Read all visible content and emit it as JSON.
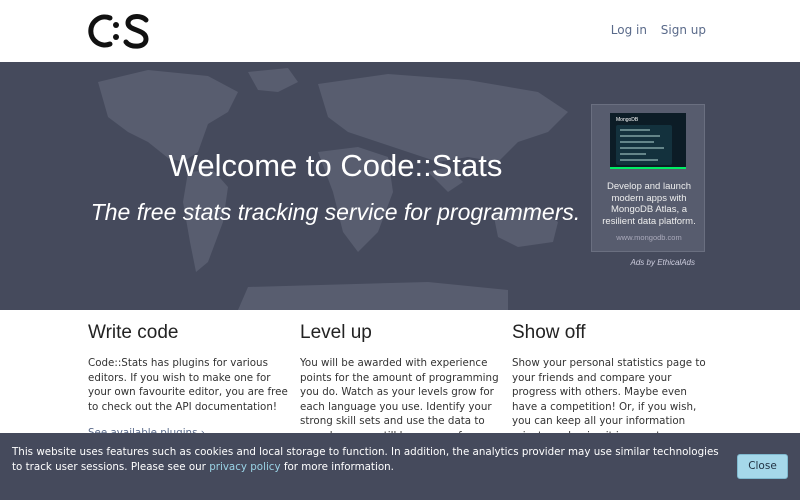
{
  "header": {
    "logo_text": "C:S",
    "nav": {
      "login": "Log in",
      "signup": "Sign up"
    }
  },
  "hero": {
    "title": "Welcome to Code::Stats",
    "subtitle": "The free stats tracking service for programmers."
  },
  "ad": {
    "image_brand": "MongoDB",
    "text": "Develop and launch modern apps with MongoDB Atlas, a resilient data platform.",
    "url": "www.mongodb.com",
    "by": "Ads by EthicalAds"
  },
  "features": [
    {
      "title": "Write code",
      "body": "Code::Stats has plugins for various editors. If you wish to make one for your own favourite editor, you are free to check out the API documentation!",
      "link": "See available plugins ›"
    },
    {
      "title": "Level up",
      "body": "You will be awarded with experience points for the amount of programming you do. Watch as your levels grow for each language you use. Identify your strong skill sets and use the data to see where you still have room for improvement."
    },
    {
      "title": "Show off",
      "body": "Show your personal statistics page to your friends and compare your progress with others. Maybe even have a competition! Or, if you wish, you can keep all your information private and enjoy it in secret."
    }
  ],
  "cookie": {
    "text_before": "This website uses features such as cookies and local storage to function. In addition, the analytics provider may use similar technologies to track user sessions. Please see our ",
    "link": "privacy policy",
    "text_after": " for more information.",
    "close": "Close"
  },
  "colors": {
    "hero_bg": "#454a5c",
    "link": "#5a6a8a",
    "button": "#a5d8ea"
  }
}
